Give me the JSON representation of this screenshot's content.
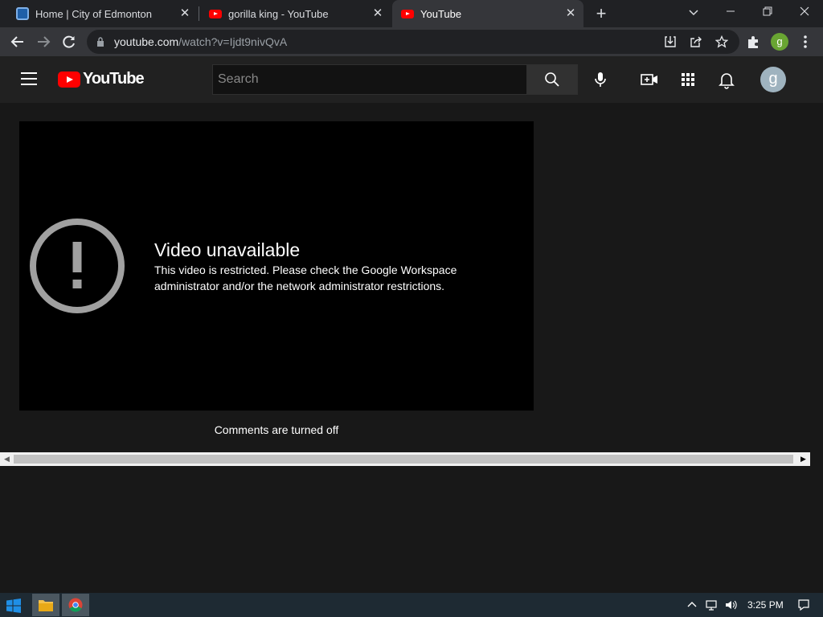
{
  "browser": {
    "tabs": [
      {
        "title": "Home | City of Edmonton",
        "favicon": "edmonton-favicon"
      },
      {
        "title": "gorilla king - YouTube",
        "favicon": "youtube-favicon"
      },
      {
        "title": "YouTube",
        "favicon": "youtube-favicon",
        "active": true
      }
    ],
    "url_host": "youtube.com",
    "url_path": "/watch?v=Ijdt9nivQvA",
    "profile_initial": "g"
  },
  "youtube": {
    "logo_text": "YouTube",
    "search_placeholder": "Search",
    "avatar_initial": "g"
  },
  "player": {
    "error_title": "Video unavailable",
    "error_message": "This video is restricted. Please check the Google Workspace administrator and/or the network administrator restrictions."
  },
  "comments": {
    "status": "Comments are turned off"
  },
  "taskbar": {
    "time": "3:25 PM"
  },
  "colors": {
    "youtube_red": "#ff0000",
    "page_bg": "#181818",
    "header_bg": "#212121"
  }
}
